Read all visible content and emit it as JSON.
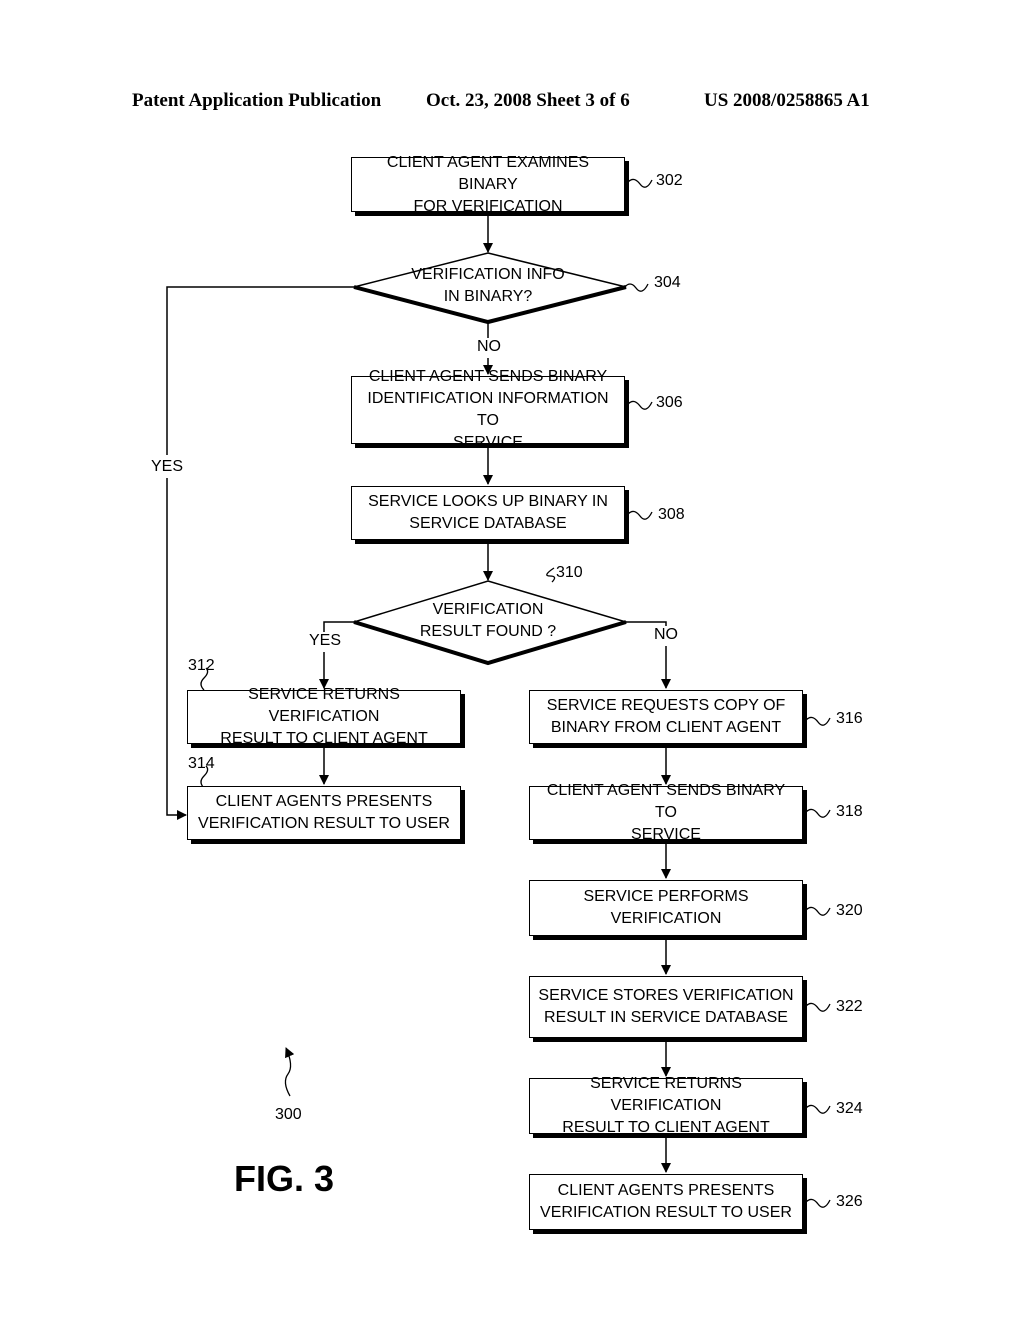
{
  "header": {
    "left": "Patent Application Publication",
    "date_sheet": "Oct. 23, 2008   Sheet 3 of 6",
    "number": "US 2008/0258865 A1"
  },
  "figure": {
    "label": "FIG. 3",
    "ref": "300"
  },
  "steps": {
    "s302": {
      "ref": "302",
      "line1": "CLIENT AGENT EXAMINES BINARY",
      "line2": "FOR VERIFICATION"
    },
    "s304": {
      "ref": "304",
      "line1": "VERIFICATION INFO",
      "line2": "IN BINARY?"
    },
    "s306": {
      "ref": "306",
      "line1": "CLIENT AGENT SENDS BINARY",
      "line2": "IDENTIFICATION INFORMATION TO",
      "line3": "SERVICE"
    },
    "s308": {
      "ref": "308",
      "line1": "SERVICE LOOKS UP BINARY IN",
      "line2": "SERVICE DATABASE"
    },
    "s310": {
      "ref": "310",
      "line1": "VERIFICATION",
      "line2": "RESULT FOUND ?"
    },
    "s312": {
      "ref": "312",
      "line1": "SERVICE RETURNS VERIFICATION",
      "line2": "RESULT TO CLIENT AGENT"
    },
    "s314": {
      "ref": "314",
      "line1": "CLIENT AGENTS PRESENTS",
      "line2": "VERIFICATION RESULT TO USER"
    },
    "s316": {
      "ref": "316",
      "line1": "SERVICE REQUESTS COPY OF",
      "line2": "BINARY FROM CLIENT AGENT"
    },
    "s318": {
      "ref": "318",
      "line1": "CLIENT AGENT SENDS BINARY TO",
      "line2": "SERVICE"
    },
    "s320": {
      "ref": "320",
      "line1": "SERVICE PERFORMS VERIFICATION"
    },
    "s322": {
      "ref": "322",
      "line1": "SERVICE STORES VERIFICATION",
      "line2": "RESULT IN SERVICE DATABASE"
    },
    "s324": {
      "ref": "324",
      "line1": "SERVICE RETURNS VERIFICATION",
      "line2": "RESULT TO CLIENT AGENT"
    },
    "s326": {
      "ref": "326",
      "line1": "CLIENT AGENTS PRESENTS",
      "line2": "VERIFICATION RESULT TO USER"
    }
  },
  "edges": {
    "yes_304": "YES",
    "no_304": "NO",
    "yes_310": "YES",
    "no_310": "NO"
  }
}
